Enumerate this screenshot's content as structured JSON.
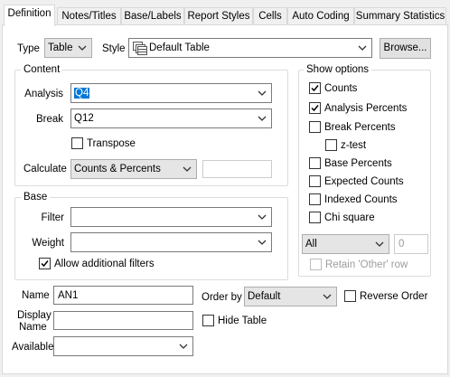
{
  "tabs": [
    "Definition",
    "Notes/Titles",
    "Base/Labels",
    "Report Styles",
    "Cells",
    "Auto Coding",
    "Summary Statistics"
  ],
  "type": {
    "label": "Type",
    "value": "Table"
  },
  "style": {
    "label": "Style",
    "value": "Default Table",
    "browse_label": "Browse..."
  },
  "content": {
    "title": "Content",
    "analysis_label": "Analysis",
    "analysis_value": "Q4",
    "break_label": "Break",
    "break_value": "Q12",
    "transpose_label": "Transpose",
    "calculate_label": "Calculate",
    "calculate_value": "Counts & Percents",
    "calculate_extra": ""
  },
  "base": {
    "title": "Base",
    "filter_label": "Filter",
    "filter_value": "",
    "weight_label": "Weight",
    "weight_value": "",
    "allow_filters_label": "Allow additional filters"
  },
  "show_options": {
    "title": "Show options",
    "counts": "Counts",
    "analysis_percents": "Analysis Percents",
    "break_percents": "Break Percents",
    "ztest": "z-test",
    "base_percents": "Base Percents",
    "expected_counts": "Expected Counts",
    "indexed_counts": "Indexed Counts",
    "chi_square": "Chi square",
    "all_value": "All",
    "number_value": "0",
    "retain_other": "Retain 'Other' row"
  },
  "bottom": {
    "name_label": "Name",
    "name_value": "AN1",
    "display_name_label_1": "Display",
    "display_name_label_2": "Name",
    "display_name_value": "",
    "available_label": "Available",
    "available_value": "",
    "order_by_label": "Order by",
    "order_by_value": "Default",
    "reverse_order_label": "Reverse Order",
    "hide_table_label": "Hide Table"
  },
  "checkbox_states": {
    "transpose": false,
    "allow_filters": true,
    "counts": true,
    "analysis_percents": true,
    "break_percents": false,
    "ztest": false,
    "base_percents": false,
    "expected_counts": false,
    "indexed_counts": false,
    "chi_square": false,
    "retain_other": false,
    "reverse_order": false,
    "hide_table": false
  },
  "colors": {
    "selection": "#0078d7",
    "window_bg": "#f0f0f0",
    "panel_bg": "#ffffff"
  },
  "icons": {
    "dropdown": "chevron-down-icon",
    "check": "checkmark-icon",
    "style": "table-style-icon"
  }
}
